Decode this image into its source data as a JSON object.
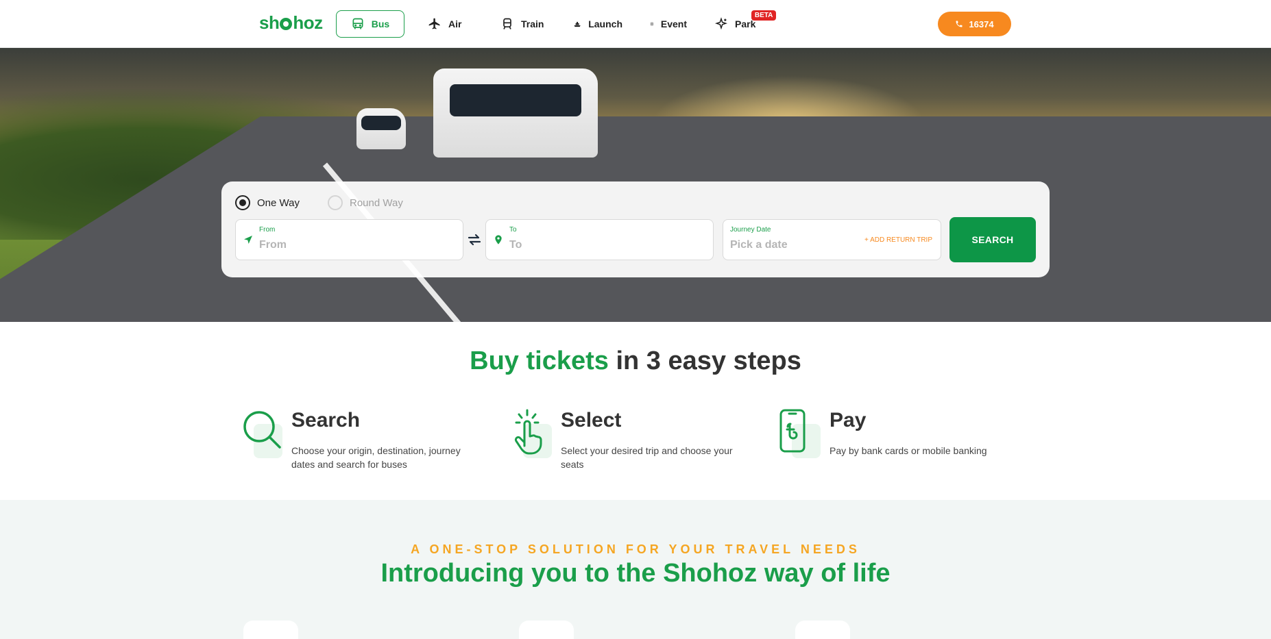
{
  "header": {
    "logo": "shohoz",
    "nav": [
      {
        "label": "Bus",
        "icon": "bus-icon",
        "active": true
      },
      {
        "label": "Air",
        "icon": "plane-icon"
      },
      {
        "label": "Train",
        "icon": "train-icon"
      },
      {
        "label": "Launch",
        "icon": "ship-icon"
      },
      {
        "label": "Event",
        "icon": "ticket-icon"
      },
      {
        "label": "Park",
        "icon": "sparkle-icon",
        "badge": "BETA"
      }
    ],
    "hotline": "16374",
    "colors": {
      "brand": "#1a9e4a",
      "accent": "#f7891f",
      "badge": "#e02424"
    }
  },
  "search": {
    "trip_types": [
      {
        "label": "One Way",
        "selected": true
      },
      {
        "label": "Round Way",
        "selected": false
      }
    ],
    "from": {
      "label": "From",
      "placeholder": "From"
    },
    "to": {
      "label": "To",
      "placeholder": "To"
    },
    "date": {
      "label": "Journey Date",
      "placeholder": "Pick a date",
      "add_return": "+ ADD RETURN TRIP"
    },
    "button": "SEARCH"
  },
  "steps": {
    "title_highlight": "Buy tickets",
    "title_rest": " in 3 easy steps",
    "items": [
      {
        "icon": "magnifier-icon",
        "title": "Search",
        "desc": "Choose your origin, destination, journey dates and search for buses"
      },
      {
        "icon": "tap-hand-icon",
        "title": "Select",
        "desc": "Select your desired trip and choose your seats"
      },
      {
        "icon": "phone-taka-icon",
        "title": "Pay",
        "desc": "Pay by bank cards or mobile banking"
      }
    ]
  },
  "intro": {
    "kicker": "A ONE-STOP SOLUTION FOR YOUR TRAVEL NEEDS",
    "title": "Introducing you to the Shohoz way of life"
  }
}
